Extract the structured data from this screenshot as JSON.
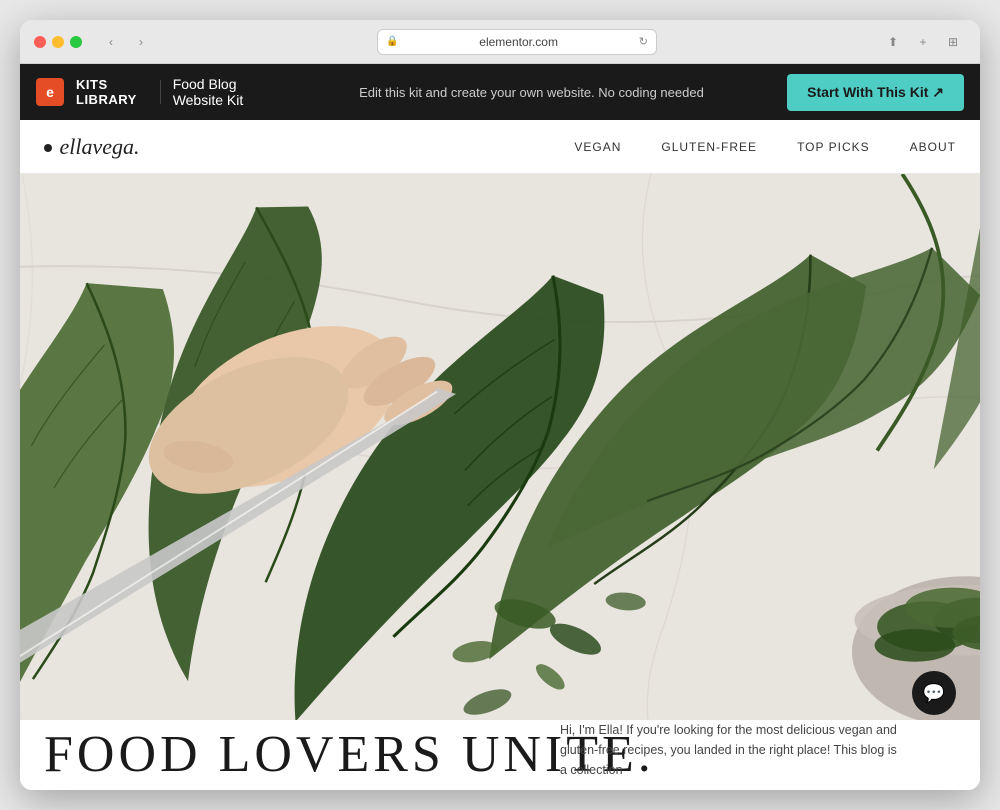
{
  "browser": {
    "url": "elementor.com",
    "traffic_lights": [
      "close",
      "minimize",
      "maximize"
    ],
    "back_label": "‹",
    "forward_label": "›",
    "reload_label": "↻",
    "share_label": "⬆",
    "add_tab_label": "+",
    "grid_label": "⊞"
  },
  "kits_bar": {
    "logo_letter": "e",
    "library_label": "KITS LIBRARY",
    "divider": "|",
    "kit_name": "Food Blog Website Kit",
    "tagline": "Edit this kit and create your own website. No coding needed",
    "cta_label": "Start With This Kit ↗"
  },
  "site_nav": {
    "logo": "ellavega.",
    "menu_items": [
      "VEGAN",
      "GLUTEN-FREE",
      "TOP PICKS",
      "ABOUT"
    ]
  },
  "hero": {
    "title": "FOOD LOVERS UNITE.",
    "description": "Hi, I'm Ella! If you're looking for the most delicious vegan and gluten-free recipes, you landed in the right place! This blog is a collection"
  },
  "chat": {
    "icon": "💬"
  }
}
